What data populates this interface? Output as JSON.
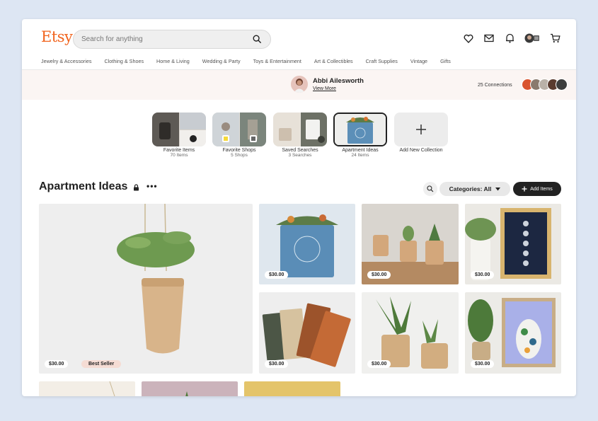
{
  "header": {
    "logo": "Etsy",
    "search_placeholder": "Search for anything"
  },
  "nav": [
    "Jewelry & Accessories",
    "Clothing & Shoes",
    "Home & Living",
    "Wedding & Party",
    "Toys & Entertainment",
    "Art & Collectibles",
    "Craft Supplies",
    "Vintage",
    "Gifts"
  ],
  "profile": {
    "name": "Abbi Ailesworth",
    "view_more": "View More",
    "connections": "25 Connections"
  },
  "collections": [
    {
      "title": "Favorite Items",
      "sub": "70 Items"
    },
    {
      "title": "Favorite Shops",
      "sub": "5 Shops"
    },
    {
      "title": "Saved Searches",
      "sub": "3 Searches"
    },
    {
      "title": "Apartment Ideas",
      "sub": "24 Items"
    },
    {
      "title": "Add New Collection",
      "sub": ""
    }
  ],
  "section": {
    "title": "Apartment Ideas",
    "categories": "Categories: All",
    "add_items": "Add Items"
  },
  "items": [
    {
      "price": "$30.00",
      "badge": "Best Seller"
    },
    {
      "price": "$30.00"
    },
    {
      "price": "$30.00"
    },
    {
      "price": "$30.00"
    },
    {
      "price": "$30.00"
    },
    {
      "price": "$30.00"
    },
    {
      "price": "$30.00"
    }
  ],
  "colors": {
    "brand": "#f1641e",
    "dark": "#222222",
    "band": "#fbf5f3"
  },
  "icons": [
    "search-icon",
    "heart-icon",
    "mail-icon",
    "bell-icon",
    "avatar",
    "cart-icon",
    "lock-icon",
    "more-icon",
    "chevron-down-icon",
    "plus-icon"
  ]
}
